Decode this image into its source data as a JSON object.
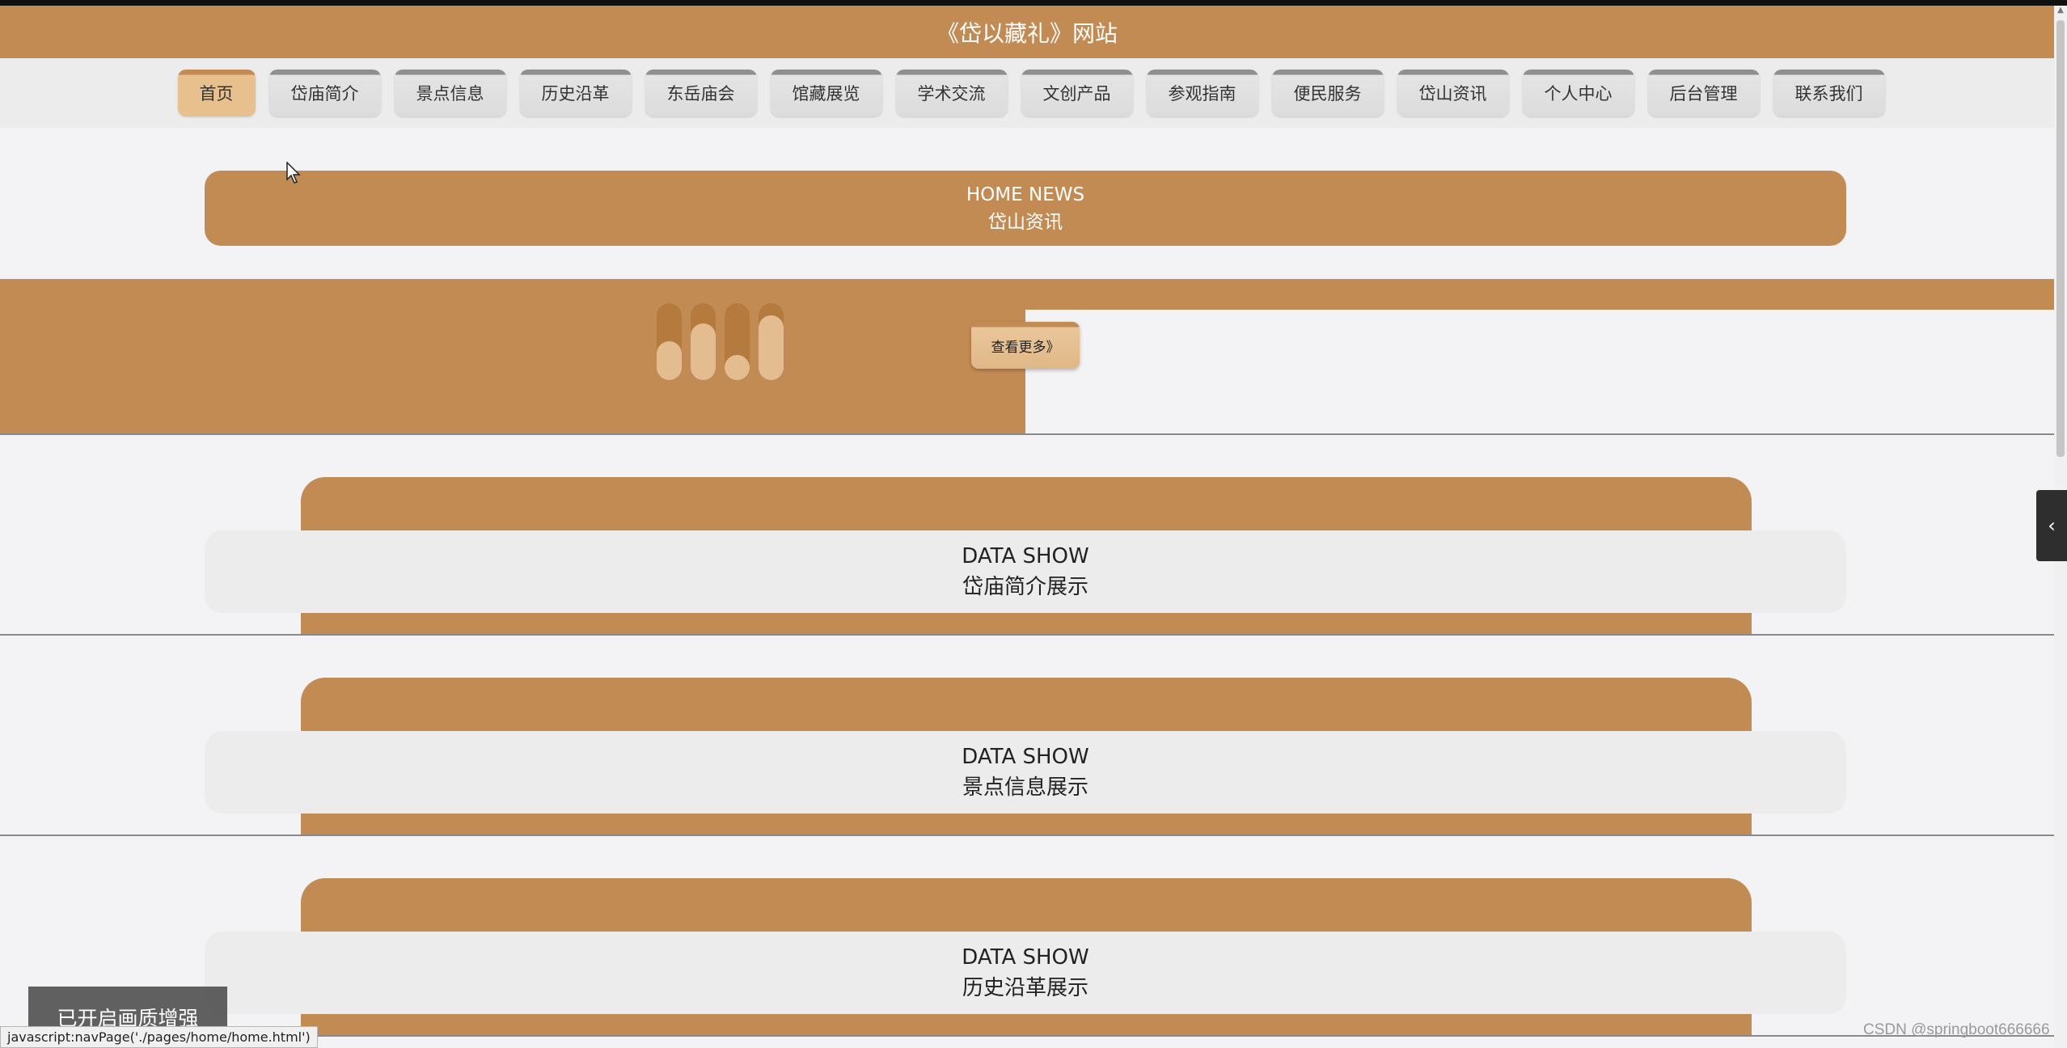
{
  "header": {
    "title": "《岱以藏礼》网站"
  },
  "nav": {
    "items": [
      {
        "label": "首页"
      },
      {
        "label": "岱庙简介"
      },
      {
        "label": "景点信息"
      },
      {
        "label": "历史沿革"
      },
      {
        "label": "东岳庙会"
      },
      {
        "label": "馆藏展览"
      },
      {
        "label": "学术交流"
      },
      {
        "label": "文创产品"
      },
      {
        "label": "参观指南"
      },
      {
        "label": "便民服务"
      },
      {
        "label": "岱山资讯"
      },
      {
        "label": "个人中心"
      },
      {
        "label": "后台管理"
      },
      {
        "label": "联系我们"
      }
    ],
    "active_index": 0
  },
  "news": {
    "title_en": "HOME NEWS",
    "title_cn": "岱山资讯",
    "more_label": "查看更多》"
  },
  "sections": [
    {
      "title_en": "DATA SHOW",
      "title_cn": "岱庙简介展示"
    },
    {
      "title_en": "DATA SHOW",
      "title_cn": "景点信息展示"
    },
    {
      "title_en": "DATA SHOW",
      "title_cn": "历史沿革展示"
    }
  ],
  "overlay": {
    "toast": "已开启画质增强",
    "status_url": "javascript:navPage('./pages/home/home.html')",
    "watermark": "CSDN @springboot666666"
  },
  "colors": {
    "accent": "#c38b54",
    "accent_light": "#e3bd90",
    "page_bg": "#f3f2f4"
  },
  "icons": {
    "loader": "loading-bars-icon",
    "side_tab": "chevron-left-icon",
    "cursor": "mouse-pointer-icon"
  }
}
